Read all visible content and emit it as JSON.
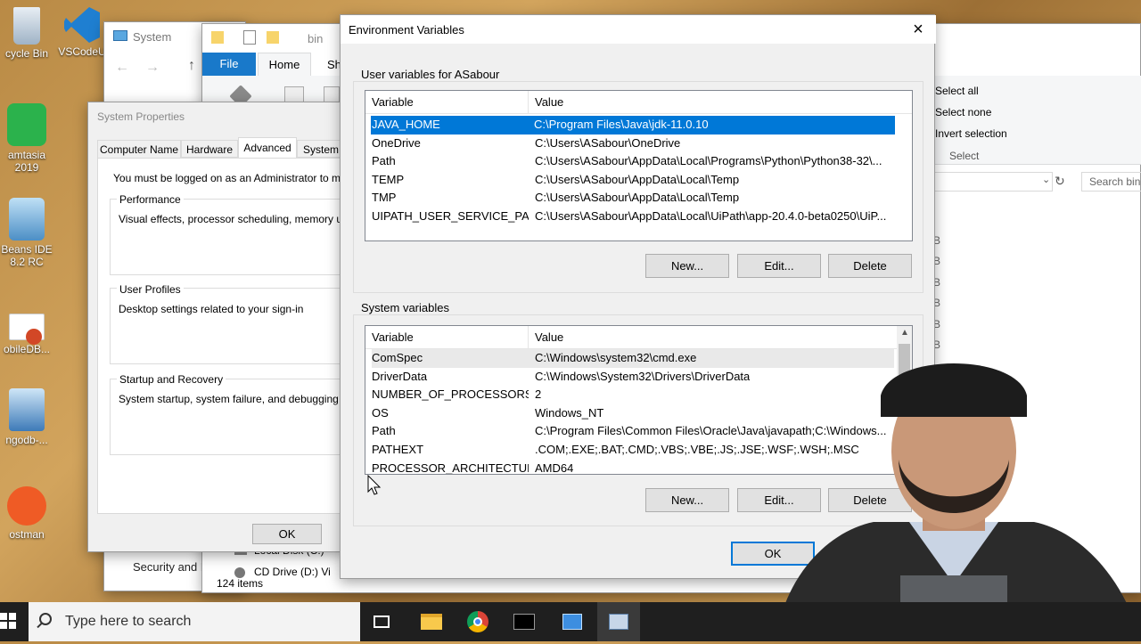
{
  "desktop": {
    "icons": [
      {
        "label": "cycle Bin"
      },
      {
        "label": "VSCodeU"
      },
      {
        "label": "amtasia 2019"
      },
      {
        "label": "Beans IDE 8.2 RC"
      },
      {
        "label": "obileDB..."
      },
      {
        "label": "ngodb-..."
      },
      {
        "label": "ostman"
      }
    ]
  },
  "system_window": {
    "title": "System",
    "nav_item": "Security and M"
  },
  "explorer": {
    "path_label": "bin",
    "tabs": [
      "File",
      "Home",
      "Sh"
    ],
    "select_all": "Select all",
    "select_none": "Select none",
    "invert_selection": "Invert selection",
    "select_group": "Select",
    "search_placeholder": "Search bin",
    "status": "124 items",
    "drive_row1": "Local Disk (C:)",
    "drive_row2": "CD Drive (D:) Vi",
    "size_unit": "B"
  },
  "system_properties": {
    "title": "System Properties",
    "tabs": [
      "Computer Name",
      "Hardware",
      "Advanced",
      "System P"
    ],
    "active_tab": "Advanced",
    "admin_note": "You must be logged on as an Administrator to mak",
    "performance_label": "Performance",
    "performance_text": "Visual effects, processor scheduling, memory usa",
    "user_profiles_label": "User Profiles",
    "user_profiles_text": "Desktop settings related to your sign-in",
    "startup_label": "Startup and Recovery",
    "startup_text": "System startup, system failure, and debugging inf",
    "ok_label": "OK"
  },
  "env_dialog": {
    "title": "Environment Variables",
    "user_group_label": "User variables for ASabour",
    "system_group_label": "System variables",
    "col_variable": "Variable",
    "col_value": "Value",
    "user_vars": [
      {
        "name": "JAVA_HOME",
        "value": "C:\\Program Files\\Java\\jdk-11.0.10"
      },
      {
        "name": "OneDrive",
        "value": "C:\\Users\\ASabour\\OneDrive"
      },
      {
        "name": "Path",
        "value": "C:\\Users\\ASabour\\AppData\\Local\\Programs\\Python\\Python38-32\\..."
      },
      {
        "name": "TEMP",
        "value": "C:\\Users\\ASabour\\AppData\\Local\\Temp"
      },
      {
        "name": "TMP",
        "value": "C:\\Users\\ASabour\\AppData\\Local\\Temp"
      },
      {
        "name": "UIPATH_USER_SERVICE_PATH",
        "value": "C:\\Users\\ASabour\\AppData\\Local\\UiPath\\app-20.4.0-beta0250\\UiP..."
      }
    ],
    "system_vars": [
      {
        "name": "ComSpec",
        "value": "C:\\Windows\\system32\\cmd.exe"
      },
      {
        "name": "DriverData",
        "value": "C:\\Windows\\System32\\Drivers\\DriverData"
      },
      {
        "name": "NUMBER_OF_PROCESSORS",
        "value": "2"
      },
      {
        "name": "OS",
        "value": "Windows_NT"
      },
      {
        "name": "Path",
        "value": "C:\\Program Files\\Common Files\\Oracle\\Java\\javapath;C:\\Windows..."
      },
      {
        "name": "PATHEXT",
        "value": ".COM;.EXE;.BAT;.CMD;.VBS;.VBE;.JS;.JSE;.WSF;.WSH;.MSC"
      },
      {
        "name": "PROCESSOR_ARCHITECTURE",
        "value": "AMD64"
      }
    ],
    "new_label": "New...",
    "edit_label": "Edit...",
    "delete_label": "Delete",
    "ok_label": "OK"
  },
  "taskbar": {
    "search_placeholder": "Type here to search"
  },
  "colors": {
    "accent": "#0078d7",
    "taskbar": "#1f1f1f",
    "dialog_bg": "#f0f0f0"
  }
}
